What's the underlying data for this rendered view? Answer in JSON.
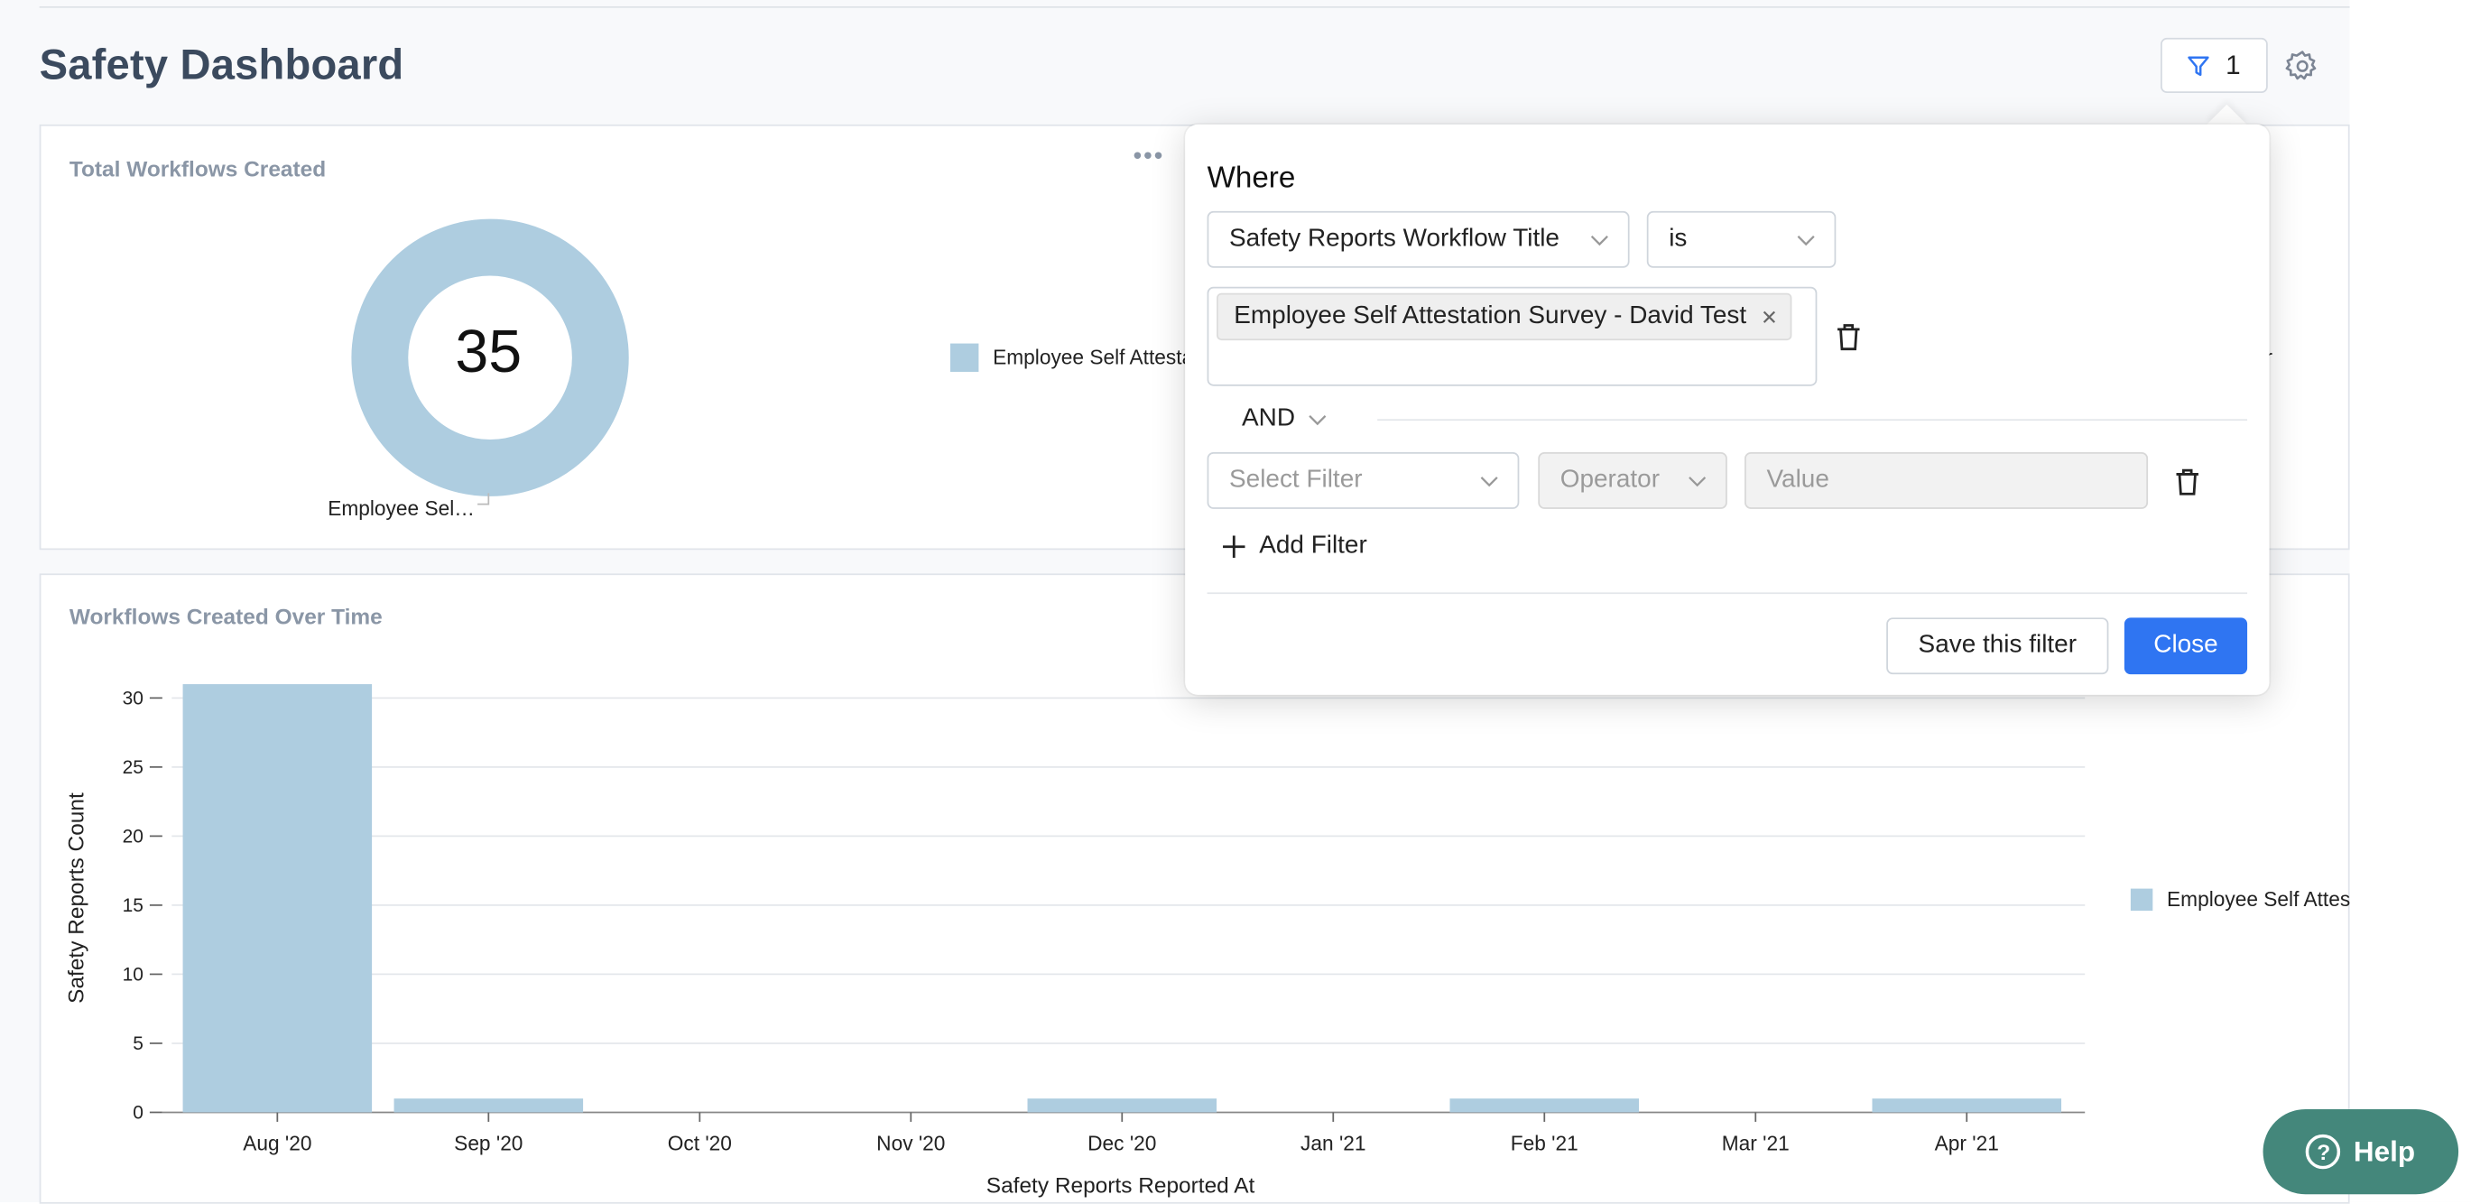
{
  "page": {
    "title": "Safety Dashboard"
  },
  "toolbar": {
    "filter_count": "1"
  },
  "donut_card": {
    "title": "Total Workflows Created",
    "total": "35",
    "slice_label": "Employee Sel…",
    "legend_label": "Employee Self Attestation Survey - David Test"
  },
  "bar_card": {
    "title": "Workflows Created Over Time",
    "legend_label": "Employee Self Attestation Survey - David Test"
  },
  "filter_popover": {
    "where_label": "Where",
    "field_select": "Safety Reports Workflow Title",
    "operator_select": "is",
    "value_tag": "Employee Self Attestation Survey - David Test",
    "conjunction": "AND",
    "new_filter_placeholder": "Select Filter",
    "new_operator_placeholder": "Operator",
    "new_value_placeholder": "Value",
    "add_filter_label": "Add Filter",
    "save_label": "Save this filter",
    "close_label": "Close"
  },
  "help": {
    "label": "Help"
  },
  "colors": {
    "series": "#aecde0",
    "primary": "#2f75f2",
    "help": "#44877b"
  },
  "chart_data": [
    {
      "type": "pie",
      "title": "Total Workflows Created",
      "donut": true,
      "center_label": "35",
      "slices": [
        {
          "label": "Employee Self Attestation Survey - David Test",
          "value": 35
        }
      ]
    },
    {
      "type": "bar",
      "title": "Workflows Created Over Time",
      "xlabel": "Safety Reports Reported At",
      "ylabel": "Safety Reports Count",
      "ylim": [
        0,
        30
      ],
      "yticks": [
        0,
        5,
        10,
        15,
        20,
        25,
        30
      ],
      "grid": true,
      "legend": "right",
      "categories": [
        "Aug '20",
        "Sep '20",
        "Oct '20",
        "Nov '20",
        "Dec '20",
        "Jan '21",
        "Feb '21",
        "Mar '21",
        "Apr '21"
      ],
      "series": [
        {
          "name": "Employee Self Attestation Survey - David Test",
          "values": [
            31,
            1,
            0,
            0,
            1,
            0,
            1,
            0,
            1
          ]
        }
      ]
    }
  ]
}
